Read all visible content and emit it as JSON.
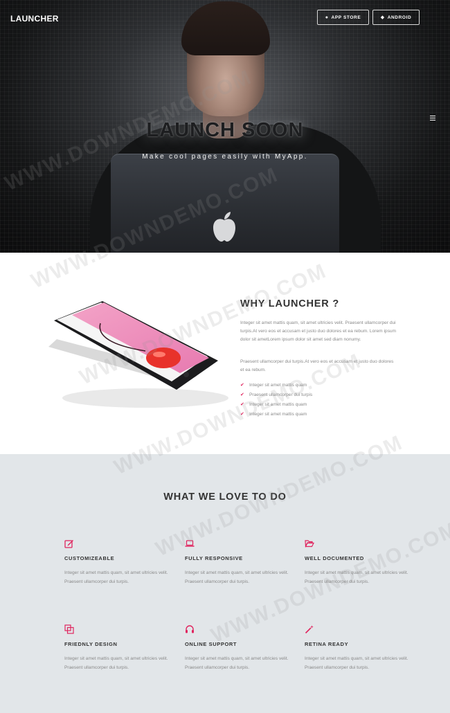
{
  "header": {
    "brand": "LAUNCHER",
    "app_store_label": "APP STORE",
    "android_label": "ANDROID",
    "menu_icon": "hamburger-menu-icon"
  },
  "hero": {
    "title": "LAUNCH SOON",
    "subtitle": "Make cool pages easily with MyApp."
  },
  "why": {
    "title": "WHY LAUNCHER ?",
    "paragraph_1": "Integer sit amet mattis quam, sit amet ultricies velit. Praesent ullamcorper dui turpis.At vero eos et accusam et justo duo dolores et ea rebum. Lorem ipsum dolor sit ametLorem ipsum dolor sit amet sed diam nonumy.",
    "paragraph_2": "Praesent ullamcorper dui turpis.At vero eos et accusam et justo duo dolores et ea rebum.",
    "list": [
      "Integer sit amet mattis quam",
      "Praesent ullamcorper dui turpis",
      "Integer sit amet mattis quam",
      "Integer sit amet mattis quam"
    ]
  },
  "love": {
    "title": "WHAT WE LOVE TO DO",
    "features": [
      {
        "icon": "edit-icon",
        "title": "CUSTOMIZEABLE",
        "desc": "Integer sit amet mattis quam, sit amet ultricies velit. Praesent ullamcorper dui turpis."
      },
      {
        "icon": "laptop-icon",
        "title": "FULLY RESPONSIVE",
        "desc": "Integer sit amet mattis quam, sit amet ultricies velit. Praesent ullamcorper dui turpis."
      },
      {
        "icon": "folder-open-icon",
        "title": "WELL DOCUMENTED",
        "desc": "Integer sit amet mattis quam, sit amet ultricies velit. Praesent ullamcorper dui turpis."
      },
      {
        "icon": "copy-icon",
        "title": "FRIEDNLY DESIGN",
        "desc": "Integer sit amet mattis quam, sit amet ultricies velit. Praesent ullamcorper dui turpis."
      },
      {
        "icon": "headphones-icon",
        "title": "ONLINE SUPPORT",
        "desc": "Integer sit amet mattis quam, sit amet ultricies velit. Praesent ullamcorper dui turpis."
      },
      {
        "icon": "magic-wand-icon",
        "title": "RETINA READY",
        "desc": "Integer sit amet mattis quam, sit amet ultricies velit. Praesent ullamcorper dui turpis."
      }
    ]
  },
  "watermark": "WWW.DOWNDEMO.COM",
  "colors": {
    "accent": "#e0245e",
    "love_bg": "#e2e6e9",
    "hero_dark": "#151617"
  }
}
